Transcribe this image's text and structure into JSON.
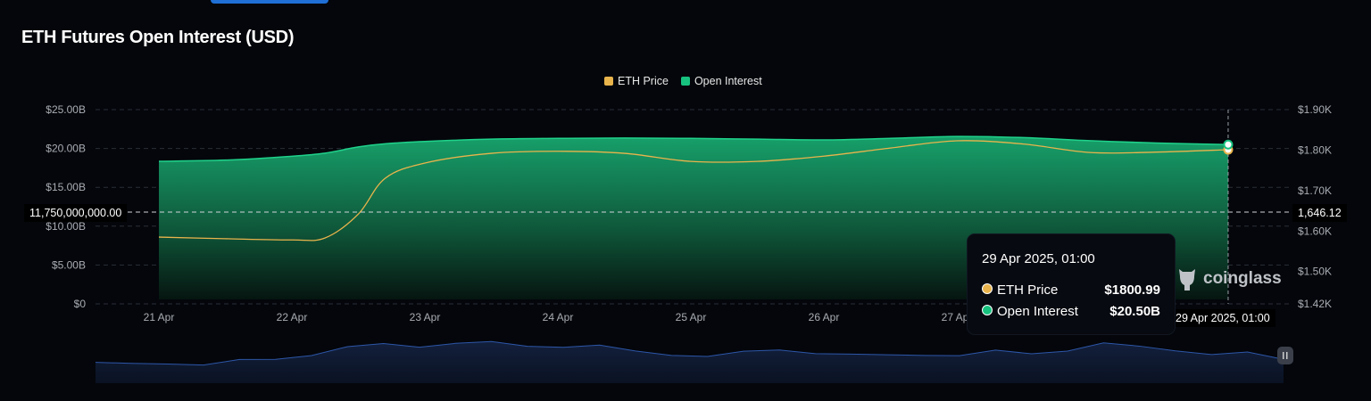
{
  "title": "ETH Futures Open Interest (USD)",
  "colors": {
    "price": "#e9b44c",
    "oi": "#17c27f",
    "background": "#04060b",
    "navigator": "#2d56a8"
  },
  "crosshair": {
    "left_value": "11,750,000,000.00",
    "right_value": "1,646.12",
    "x_label": "29 Apr 2025, 01:00"
  },
  "tooltip": {
    "title": "29 Apr 2025, 01:00",
    "rows": [
      {
        "label": "ETH Price",
        "value": "$1800.99"
      },
      {
        "label": "Open Interest",
        "value": "$20.50B"
      }
    ]
  },
  "watermark": "coinglass",
  "chart_data": {
    "type": "line",
    "title": "ETH Futures Open Interest (USD)",
    "legend": [
      "ETH Price",
      "Open Interest"
    ],
    "legend_position": "top-center",
    "x_ticks": [
      "21 Apr",
      "22 Apr",
      "23 Apr",
      "24 Apr",
      "25 Apr",
      "26 Apr",
      "27 Apr"
    ],
    "x_days": [
      21,
      21.5,
      22,
      22.25,
      22.5,
      22.7,
      23,
      23.5,
      24,
      24.5,
      25,
      25.5,
      26,
      26.5,
      27,
      27.5,
      28,
      28.5,
      29.04
    ],
    "y_left": {
      "ticks": [
        "$0",
        "$5.00B",
        "$10.00B",
        "$15.00B",
        "$20.00B",
        "$25.00B"
      ],
      "range": [
        0,
        25
      ]
    },
    "y_right": {
      "ticks": [
        "$1.42K",
        "$1.50K",
        "$1.60K",
        "$1.70K",
        "$1.80K",
        "$1.90K"
      ],
      "range": [
        1420,
        1900
      ]
    },
    "series": [
      {
        "name": "Open Interest",
        "axis": "left",
        "unit": "B USD",
        "values": [
          18.35,
          18.5,
          19.0,
          19.4,
          20.2,
          20.6,
          20.9,
          21.2,
          21.3,
          21.35,
          21.3,
          21.2,
          21.1,
          21.3,
          21.55,
          21.4,
          21.0,
          20.7,
          20.5
        ]
      },
      {
        "name": "ETH Price",
        "axis": "right",
        "unit": "USD",
        "values": [
          1585,
          1581,
          1578,
          1583,
          1642,
          1730,
          1768,
          1792,
          1797,
          1792,
          1772,
          1772,
          1785,
          1805,
          1823,
          1815,
          1794,
          1795,
          1800.99
        ]
      }
    ],
    "navigator": [
      0.2,
      0.22,
      0.25,
      0.27,
      0.3,
      0.35,
      0.5,
      0.62,
      0.75,
      0.7,
      0.85,
      0.78,
      0.7,
      0.72,
      0.66,
      0.55,
      0.48,
      0.5,
      0.52,
      0.6,
      0.55,
      0.42,
      0.45,
      0.48,
      0.52,
      0.55,
      0.5,
      0.62,
      0.72,
      0.68,
      0.6,
      0.55,
      0.5,
      0.35
    ]
  }
}
